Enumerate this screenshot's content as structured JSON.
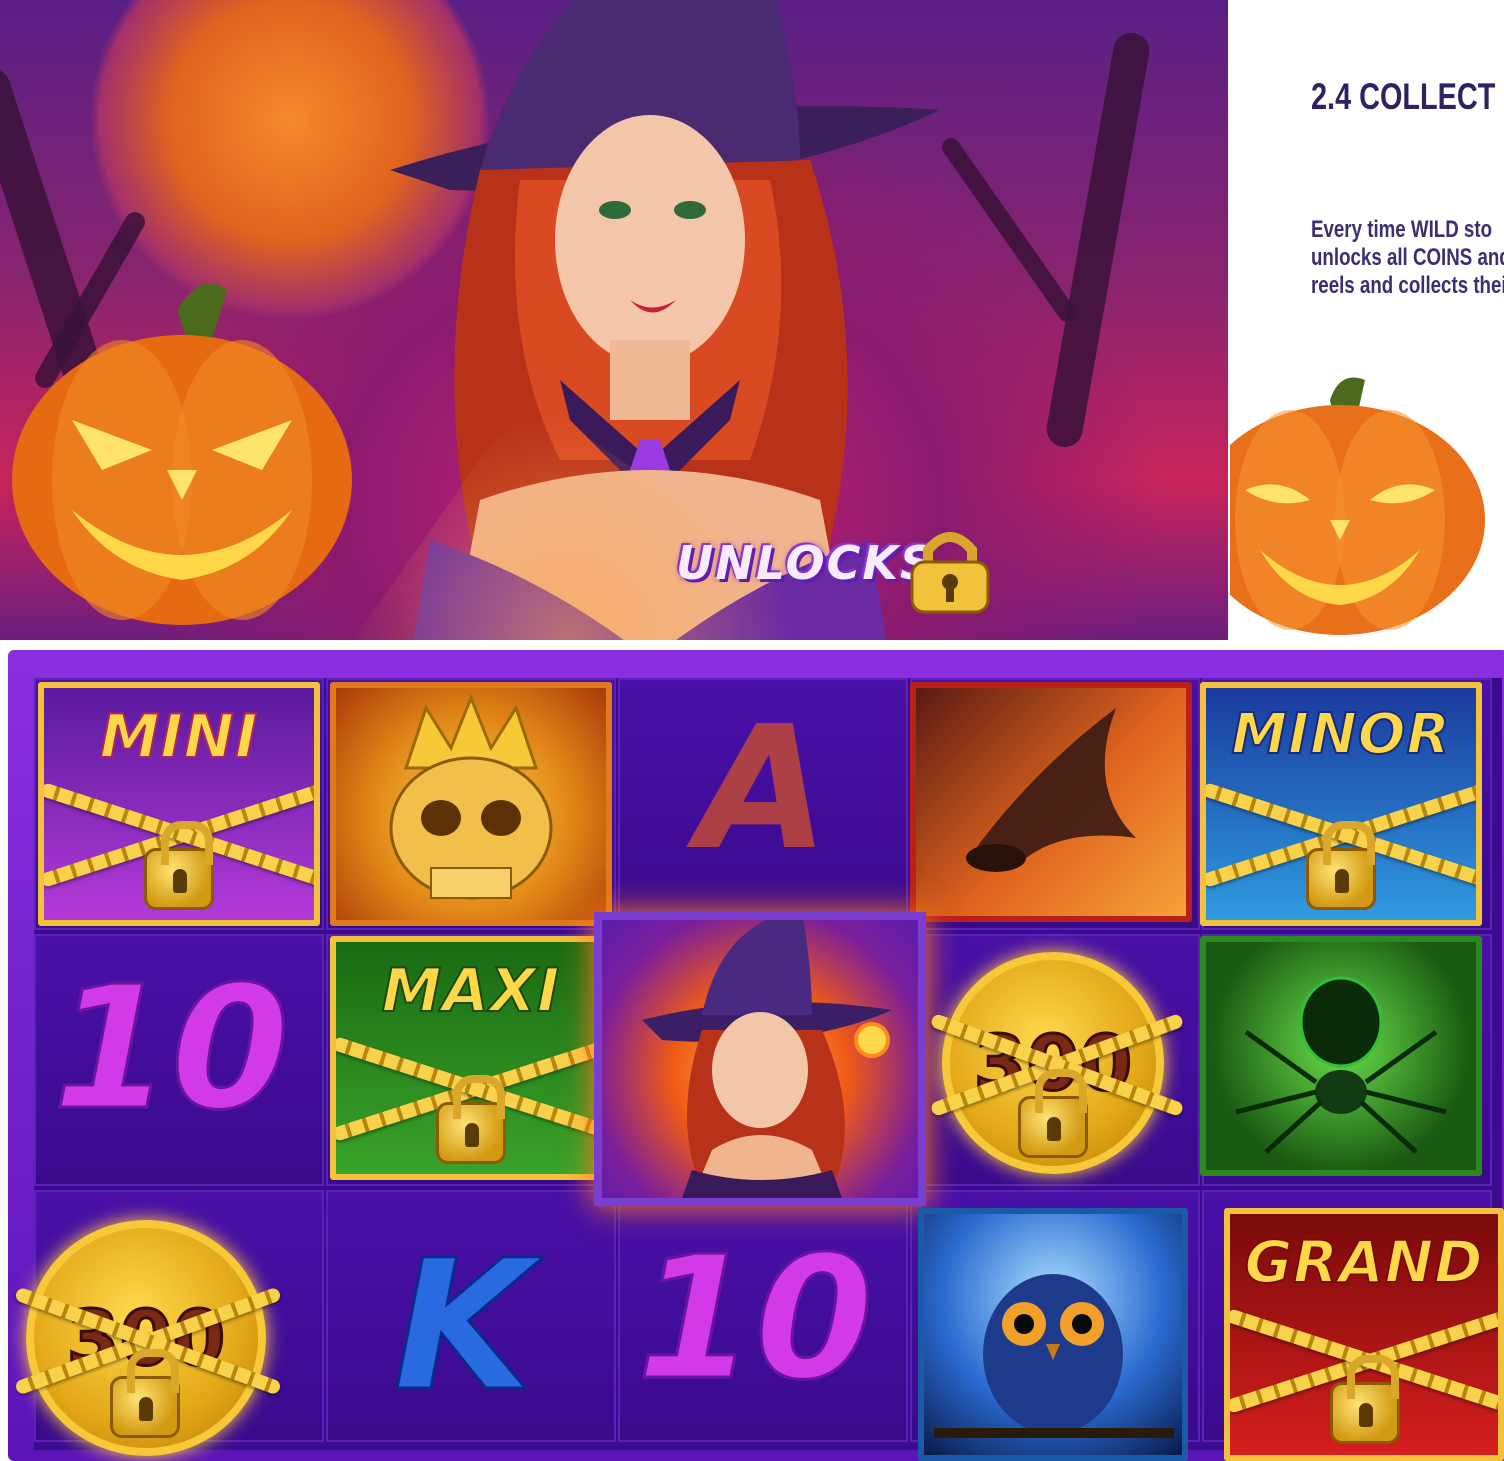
{
  "hero": {
    "banner_word": "UNLOCKS"
  },
  "panel": {
    "heading": "2.4 COLLECT",
    "body_lines": [
      "Every time WILD sto",
      "unlocks all COINS and",
      "reels and collects thei"
    ]
  },
  "reels": {
    "jackpot_labels": {
      "mini": "MINI",
      "minor": "MINOR",
      "maxi": "MAXI",
      "grand": "GRAND"
    },
    "coin_values": [
      "300",
      "300"
    ],
    "card_symbols": {
      "ghost_a": "A",
      "ten_1": "10",
      "ten_2": "10",
      "king": "K"
    },
    "picture_symbols": [
      "crown-skull",
      "bat",
      "witch-wild",
      "spider",
      "owl"
    ]
  },
  "colors": {
    "mini_bg": "#a63ad0",
    "minor_bg": "#2f9be0",
    "maxi_bg": "#2f8f1e",
    "grand_bg": "#d61e1e",
    "reel_bg": "#3b0c8e",
    "frame": "#8a2ee0",
    "gold": "#f7c838",
    "heading": "#2b2463"
  }
}
